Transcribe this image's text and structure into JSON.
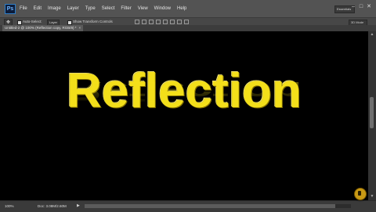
{
  "app": {
    "logo": "Ps"
  },
  "menu": [
    "File",
    "Edit",
    "Image",
    "Layer",
    "Type",
    "Select",
    "Filter",
    "View",
    "Window",
    "Help"
  ],
  "workspace_label": "Essentials",
  "window_controls": {
    "minimize": "–",
    "maximize": "□",
    "close": "✕"
  },
  "options_bar": {
    "auto_select_label": "Auto-Select:",
    "auto_select_value": "Layer",
    "show_transform_label": "Show Transform Controls",
    "right_select": "3D Mode"
  },
  "document_tab": {
    "title": "Untitled-2 @ 100% (Reflection copy, RGB/8) *",
    "close": "×"
  },
  "canvas": {
    "text": "Reflection",
    "text_color": "#f3df1a",
    "background": "#000000"
  },
  "status_bar": {
    "zoom": "100%",
    "doc_info": "Doc: 3.08M/2.60M",
    "arrow": "▶"
  },
  "colors": {
    "menubar": "#535353",
    "options_bar": "#474747",
    "accent_text": "#f3df1a"
  }
}
